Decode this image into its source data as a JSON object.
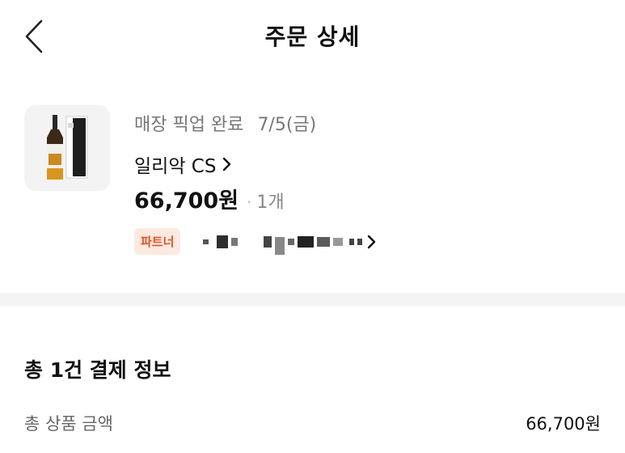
{
  "header": {
    "title": "주문 상세",
    "back_icon": "chevron-left-icon"
  },
  "order": {
    "status": "매장 픽업 완료",
    "date": "7/5(금)",
    "store_name": "일리악 CS",
    "price": "66,700원",
    "quantity": "1개",
    "partner_badge": "파트너"
  },
  "payment_summary": {
    "title": "총 1건 결제 정보",
    "total_label": "총 상품 금액",
    "total_value": "66,700원"
  },
  "colors": {
    "partner_badge_bg": "#fde9e1",
    "partner_badge_text": "#e2542a"
  }
}
